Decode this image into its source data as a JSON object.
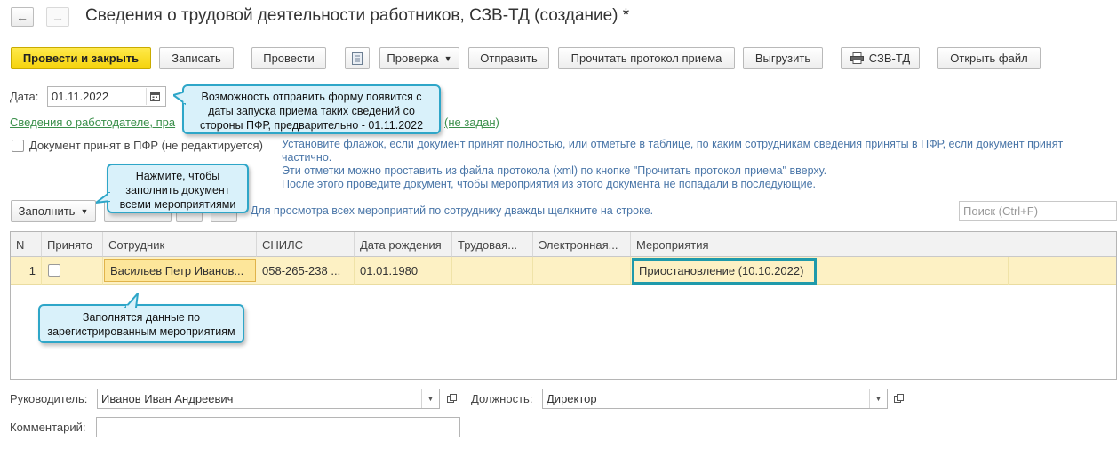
{
  "window": {
    "title": "Сведения о трудовой деятельности работников, СЗВ-ТД (создание) *",
    "nav_back": "←",
    "nav_forward": "→"
  },
  "toolbar": {
    "post_close": "Провести и закрыть",
    "save": "Записать",
    "post": "Провести",
    "check": "Проверка",
    "send": "Отправить",
    "read_protocol": "Прочитать протокол приема",
    "export": "Выгрузить",
    "print_szv": "СЗВ-ТД",
    "open_file": "Открыть файл"
  },
  "form": {
    "date_label": "Дата:",
    "date_value": "01.11.2022",
    "employer_link_left": "Сведения о работодателе, пра",
    "employer_link_right": "(не задан)",
    "accepted_label": "Документ принят в ПФР (не редактируется)",
    "hint_lines": [
      "Установите флажок, если документ принят полностью, или отметьте в таблице, по каким сотрудникам сведения приняты в ПФР, если документ принят",
      "частично.",
      "Эти отметки можно проставить из файла протокола (xml) по кнопке \"Прочитать протокол приема\" вверху.",
      "После этого проведите документ, чтобы мероприятия из этого документа не попадали в последующие."
    ],
    "fill_button": "Заполнить",
    "grid_hint": "Для просмотра всех мероприятий по сотруднику дважды щелкните на строке.",
    "search_placeholder": "Поиск (Ctrl+F)"
  },
  "table": {
    "columns": [
      "N",
      "Принято",
      "Сотрудник",
      "СНИЛС",
      "Дата рождения",
      "Трудовая...",
      "Электронная...",
      "Мероприятия"
    ],
    "rows": [
      {
        "n": "1",
        "accepted": false,
        "employee": "Васильев Петр Иванов...",
        "snils": "058-265-238 ...",
        "birth_date": "01.01.1980",
        "labor": "",
        "electronic": "",
        "events": "Приостановление (10.10.2022)"
      }
    ]
  },
  "footer": {
    "head_label": "Руководитель:",
    "head_value": "Иванов Иван Андреевич",
    "position_label": "Должность:",
    "position_value": "Директор",
    "comment_label": "Комментарий:",
    "comment_value": ""
  },
  "callouts": {
    "top": "Возможность отправить форму появится с даты запуска приема таких сведений со стороны ПФР, предварительно - 01.11.2022",
    "fill": "Нажмите, чтобы заполнить документ всеми мероприятиями",
    "data": "Заполнятся данные по зарегистрированным мероприятиям"
  },
  "colors": {
    "primary_button": "#f5d30c",
    "callout_border": "#2ea6c8",
    "callout_bg": "#d9f1fa",
    "selected_row": "#fdf1c4",
    "link": "#3a8f4a",
    "hint": "#4a76a8"
  }
}
